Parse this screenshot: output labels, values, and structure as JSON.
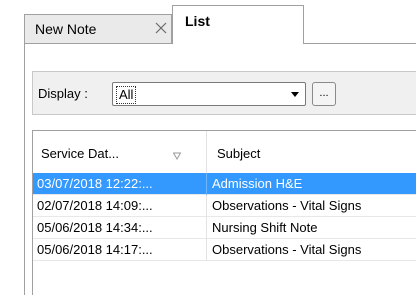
{
  "tabs": [
    {
      "label": "New Note",
      "active": false,
      "closable": true
    },
    {
      "label": "List",
      "active": true,
      "closable": false
    }
  ],
  "filter": {
    "display_label": "Display :",
    "display_value": "All",
    "ellipsis_label": "..."
  },
  "grid": {
    "columns": [
      {
        "label": "Service Dat...",
        "sort": "descending"
      },
      {
        "label": "Subject"
      }
    ],
    "rows": [
      {
        "date": "03/07/2018 12:22:...",
        "subject": "Admission H&E",
        "selected": true
      },
      {
        "date": "02/07/2018 14:09:...",
        "subject": "Observations - Vital Signs",
        "selected": false
      },
      {
        "date": "05/06/2018 14:34:...",
        "subject": "Nursing Shift Note",
        "selected": false
      },
      {
        "date": "05/06/2018 14:17:...",
        "subject": "Observations - Vital Signs",
        "selected": false
      }
    ]
  },
  "colors": {
    "selection": "#3399ff",
    "tab_inactive": "#eaeaea",
    "filter_bar": "#f0f0f0"
  },
  "icons": {
    "tab_close": "close-icon",
    "sort": "sort-descending-icon",
    "dropdown": "chevron-down-icon"
  }
}
